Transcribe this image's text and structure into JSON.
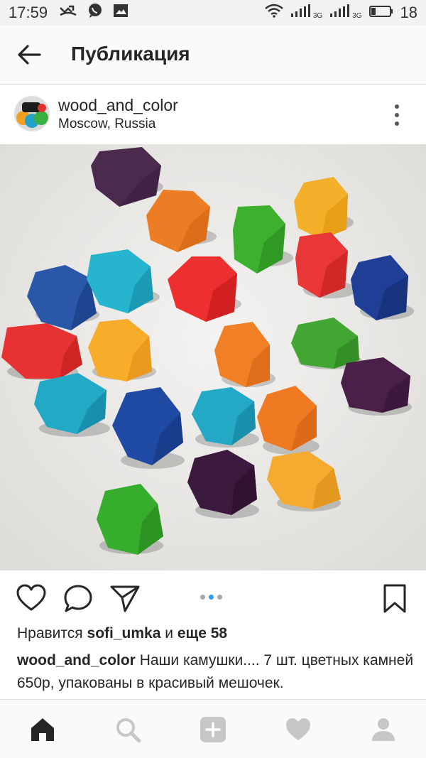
{
  "status_bar": {
    "time": "17:59",
    "network_label_1": "3G",
    "network_label_2": "3G",
    "battery_level": "18",
    "icons": [
      "missed-call-icon",
      "viber-icon",
      "picture-notification-icon",
      "wifi-icon",
      "signal-icon",
      "battery-icon"
    ]
  },
  "header": {
    "title": "Публикация",
    "back_icon": "arrow-left-icon"
  },
  "post": {
    "username": "wood_and_color",
    "location": "Moscow, Russia",
    "more_icon": "more-vertical-icon",
    "photo_icon": "wooden-stones-photo",
    "carousel": {
      "count": 3,
      "active_index": 1
    }
  },
  "actions": {
    "icons": [
      "heart-icon",
      "comment-icon",
      "share-icon",
      "bookmark-icon"
    ]
  },
  "likes": {
    "prefix": "Нравится",
    "user": "sofi_umka",
    "connector": "и",
    "more": "еще 58"
  },
  "caption": {
    "author": "wood_and_color",
    "text": "Наши камушки.... 7 шт. цветных камней 650р, упакованы в красивый мешочек."
  },
  "bottom_nav": {
    "icons": [
      "home-icon",
      "search-icon",
      "add-icon",
      "activity-heart-icon",
      "profile-icon"
    ],
    "active": "home-icon"
  },
  "colors": {
    "accent_blue": "#3897f0",
    "text": "#262626",
    "inactive_icon": "#c7c7c7"
  }
}
